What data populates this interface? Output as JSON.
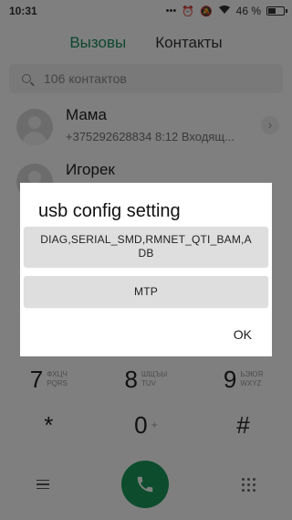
{
  "status_bar": {
    "time": "10:31",
    "icons": [
      "dots-icon",
      "alarm-icon",
      "mute-icon",
      "wifi-icon"
    ],
    "battery_text": "46 %",
    "battery_level": 0.46
  },
  "tabs": [
    {
      "label": "Вызовы",
      "active": true
    },
    {
      "label": "Контакты",
      "active": false
    }
  ],
  "search": {
    "placeholder": "106 контактов"
  },
  "contacts": [
    {
      "name": "Мама",
      "detail": "+375292628834 8:12 Входящ..."
    },
    {
      "name": "Игорек",
      "detail": ""
    }
  ],
  "dialpad": {
    "keys": [
      {
        "digit": "7",
        "letters1": "ФХЦЧ",
        "letters2": "PQRS"
      },
      {
        "digit": "8",
        "letters1": "ШЩЪЫ",
        "letters2": "TUV"
      },
      {
        "digit": "9",
        "letters1": "ЬЭЮЯ",
        "letters2": "WXYZ"
      },
      {
        "digit": "*",
        "letters1": "",
        "letters2": ""
      },
      {
        "digit": "0",
        "letters1": "+",
        "letters2": ""
      },
      {
        "digit": "#",
        "letters1": "",
        "letters2": ""
      }
    ]
  },
  "dialog": {
    "title": "usb config setting",
    "options": [
      "DIAG,SERIAL_SMD,RMNET_QTI_BAM,ADB",
      "MTP"
    ],
    "option1_lines": [
      "DIAG,SERIAL_SMD,RMNET_QTI_BAM,A",
      "DB"
    ],
    "ok_label": "OK"
  },
  "colors": {
    "accent": "#1a8f5e",
    "call_button": "#1a9a5c"
  }
}
